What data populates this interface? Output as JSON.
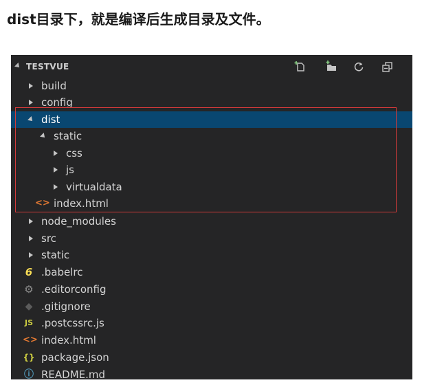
{
  "caption": "dist目录下，就是编译后生成目录及文件。",
  "explorer": {
    "title": "TESTVUE",
    "toolbar": [
      {
        "name": "new-file-icon"
      },
      {
        "name": "new-folder-icon"
      },
      {
        "name": "refresh-icon"
      },
      {
        "name": "collapse-all-icon"
      }
    ],
    "tree": {
      "build": "build",
      "config": "config",
      "dist": "dist",
      "static_sub": "static",
      "css": "css",
      "js": "js",
      "virtualdata": "virtualdata",
      "dist_index": "index.html",
      "node_modules": "node_modules",
      "src": "src",
      "static": "static",
      "babelrc": ".babelrc",
      "editorconfig": ".editorconfig",
      "gitignore": ".gitignore",
      "postcssrc": ".postcssrc.js",
      "index": "index.html",
      "package": "package.json",
      "readme": "README.md"
    },
    "colors": {
      "background": "#252526",
      "selection": "#094771",
      "highlight_border": "#d23a3a",
      "html_icon": "#e37933",
      "js_icon": "#cbcb41",
      "babel_icon": "#f5da55",
      "json_icon": "#cbcb41",
      "info_icon": "#519aba"
    }
  }
}
